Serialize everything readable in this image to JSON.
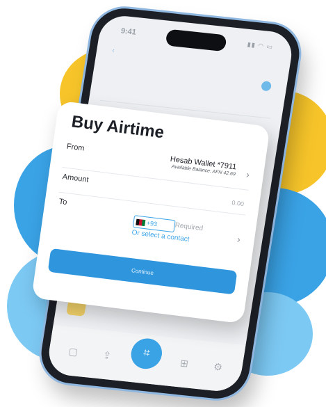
{
  "colors": {
    "accent": "#3aa3e6",
    "yellow": "#f7c52a",
    "sky": "#7cc9f4",
    "phone_frame": "#1c1f26"
  },
  "form": {
    "title": "Buy Airtime",
    "from_label": "From",
    "wallet_name": "Hesab Wallet *7911",
    "balance": "Available Balance: AFN 42.69",
    "amount_label": "Amount",
    "amount_placeholder": "0.00",
    "to_label": "To",
    "country_code": "+93",
    "required_text": "Required",
    "select_contact_link": "Or select a contact",
    "continue_label": "Continue"
  },
  "background_screen": {
    "time": "9:41"
  }
}
